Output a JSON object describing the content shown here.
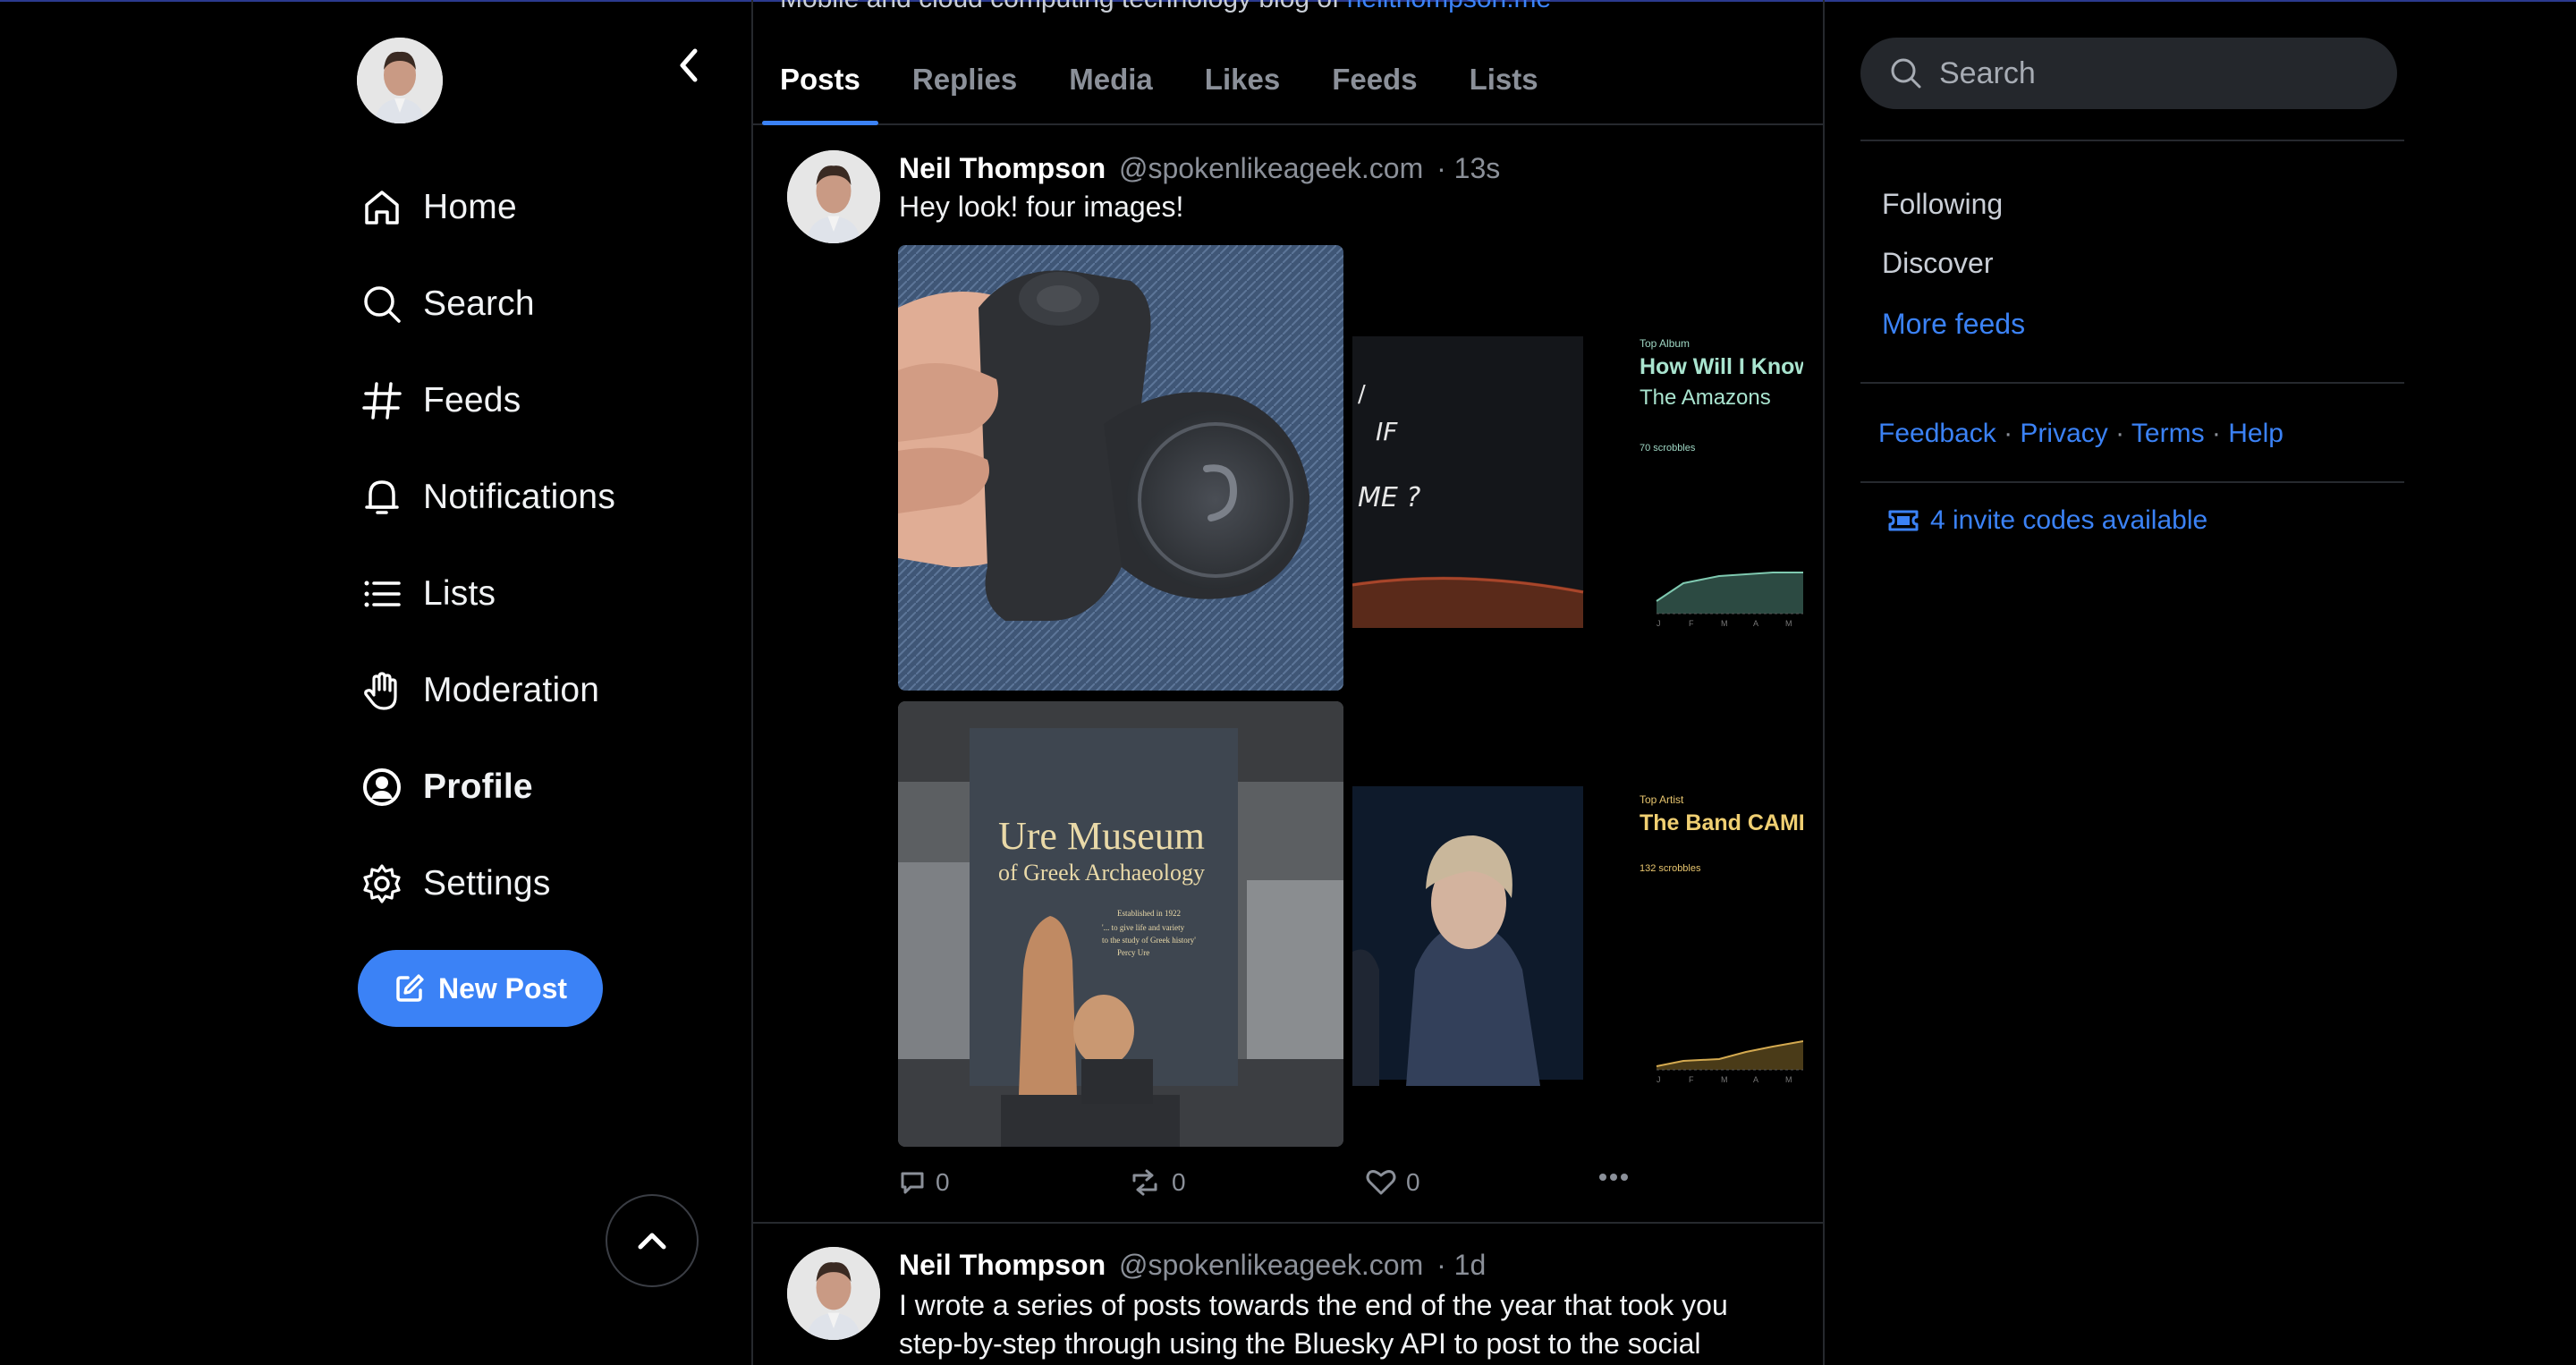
{
  "nav": {
    "items": [
      {
        "label": "Home",
        "icon": "home-icon"
      },
      {
        "label": "Search",
        "icon": "search-icon"
      },
      {
        "label": "Feeds",
        "icon": "hash-icon"
      },
      {
        "label": "Notifications",
        "icon": "bell-icon"
      },
      {
        "label": "Lists",
        "icon": "list-icon"
      },
      {
        "label": "Moderation",
        "icon": "hand-icon"
      },
      {
        "label": "Profile",
        "icon": "user-circle-icon"
      },
      {
        "label": "Settings",
        "icon": "gear-icon"
      }
    ],
    "active": "Profile",
    "new_post_label": "New Post"
  },
  "profile": {
    "bio_text": "Mobile and cloud computing technology blog of ",
    "bio_link": "neilthompson.me"
  },
  "tabs": [
    "Posts",
    "Replies",
    "Media",
    "Likes",
    "Feeds",
    "Lists"
  ],
  "active_tab": "Posts",
  "posts": [
    {
      "name": "Neil Thompson",
      "handle": "@spokenlikeageek.com",
      "time": "· 13s",
      "text": "Hey look! four images!",
      "replies": "0",
      "reposts": "0",
      "likes": "0",
      "images": {
        "museum_title": "Ure Museum",
        "museum_subtitle": "of Greek Archaeology",
        "museum_small_1": "Established in 1922",
        "museum_small_2": "'... to give life and variety",
        "museum_small_3": "to the study of Greek history'",
        "museum_small_4": "Percy Ure",
        "album_tag": "Top Album",
        "album_title": "How Will I Know",
        "album_artist": "The Amazons",
        "album_scrobbles": "70 scrobbles",
        "artist_tag": "Top Artist",
        "artist_title": "The Band CAMINO",
        "artist_scrobbles": "132 scrobbles",
        "months": [
          "J",
          "F",
          "M",
          "A",
          "M"
        ],
        "handwriting_1": "IF",
        "handwriting_2": "ME ?"
      }
    },
    {
      "name": "Neil Thompson",
      "handle": "@spokenlikeageek.com",
      "time": "· 1d",
      "text": "I wrote a series of posts towards the end of the year that took you step-by-step through using the Bluesky API to post to the social"
    }
  ],
  "right": {
    "search_placeholder": "Search",
    "feeds": [
      "Following",
      "Discover"
    ],
    "more_feeds": "More feeds",
    "footer": [
      "Feedback",
      "Privacy",
      "Terms",
      "Help"
    ],
    "invite_label": "4 invite codes available"
  },
  "colors": {
    "accent": "#3b82f6",
    "background": "#000000",
    "border": "#26292e",
    "muted": "#8b9099"
  }
}
